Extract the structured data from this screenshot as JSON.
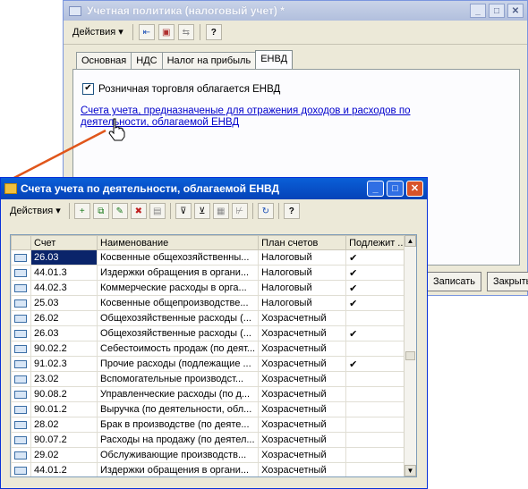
{
  "back_window": {
    "title": "Учетная политика (налоговый учет) *",
    "actions_label": "Действия",
    "tabs": [
      "Основная",
      "НДС",
      "Налог на прибыль",
      "ЕНВД"
    ],
    "active_tab": "ЕНВД",
    "checkbox_label": "Розничная торговля облагается ЕНВД",
    "checkbox_checked": true,
    "link_text": "Счета учета, предназначеные для отражения  доходов и расходов по деятельности, облагаемой ЕНВД",
    "buttons": {
      "write": "Записать",
      "close": "Закрыть"
    }
  },
  "front_window": {
    "title": "Счета учета по деятельности, облагаемой ЕНВД",
    "actions_label": "Действия",
    "columns": [
      "Счет",
      "Наименование",
      "План счетов",
      "Подлежит ..."
    ],
    "rows": [
      {
        "account": "26.03",
        "name": "Косвенные общехозяйственны...",
        "plan": "Налоговый",
        "flag": "✔"
      },
      {
        "account": "44.01.3",
        "name": "Издержки обращения в органи...",
        "plan": "Налоговый",
        "flag": "✔"
      },
      {
        "account": "44.02.3",
        "name": "Коммерческие расходы в орга...",
        "plan": "Налоговый",
        "flag": "✔"
      },
      {
        "account": "25.03",
        "name": "Косвенные общепроизводстве...",
        "plan": "Налоговый",
        "flag": "✔"
      },
      {
        "account": "26.02",
        "name": "Общехозяйственные расходы (...",
        "plan": "Хозрасчетный",
        "flag": ""
      },
      {
        "account": "26.03",
        "name": "Общехозяйственные расходы (...",
        "plan": "Хозрасчетный",
        "flag": "✔"
      },
      {
        "account": "90.02.2",
        "name": "Себестоимость продаж (по деят...",
        "plan": "Хозрасчетный",
        "flag": ""
      },
      {
        "account": "91.02.3",
        "name": "Прочие расходы (подлежащие ...",
        "plan": "Хозрасчетный",
        "flag": "✔"
      },
      {
        "account": "23.02",
        "name": "Вспомогательные производст...",
        "plan": "Хозрасчетный",
        "flag": ""
      },
      {
        "account": "90.08.2",
        "name": "Управленческие расходы (по д...",
        "plan": "Хозрасчетный",
        "flag": ""
      },
      {
        "account": "90.01.2",
        "name": "Выручка (по деятельности, обл...",
        "plan": "Хозрасчетный",
        "flag": ""
      },
      {
        "account": "28.02",
        "name": "Брак в производстве (по деяте...",
        "plan": "Хозрасчетный",
        "flag": ""
      },
      {
        "account": "90.07.2",
        "name": "Расходы на продажу (по деятел...",
        "plan": "Хозрасчетный",
        "flag": ""
      },
      {
        "account": "29.02",
        "name": "Обслуживающие производств...",
        "plan": "Хозрасчетный",
        "flag": ""
      },
      {
        "account": "44.01.2",
        "name": "Издержки обращения в органи...",
        "plan": "Хозрасчетный",
        "flag": ""
      }
    ],
    "selected_row": 0
  },
  "colors": {
    "link": "#0000cc",
    "title_active": "#0a5fd8",
    "connector": "#e0561b",
    "check": "#000000"
  }
}
